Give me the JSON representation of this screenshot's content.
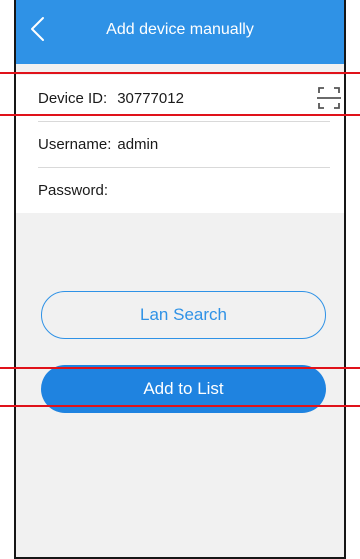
{
  "header": {
    "title": "Add device manually",
    "back_icon": "chevron-left-icon"
  },
  "form": {
    "device_id": {
      "label": "Device ID:",
      "value": "30777012",
      "scan_icon": "qr-scan-icon"
    },
    "username": {
      "label": "Username:",
      "value": "admin"
    },
    "password": {
      "label": "Password:",
      "value": ""
    }
  },
  "actions": {
    "lan_search_label": "Lan Search",
    "add_to_list_label": "Add to List"
  },
  "colors": {
    "brand_blue": "#2f92e6",
    "primary_button": "#1f83e0",
    "background": "#f1f1f1",
    "annotation_red": "#e0121a"
  }
}
